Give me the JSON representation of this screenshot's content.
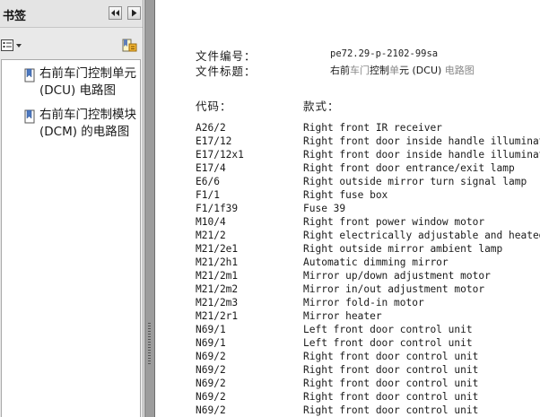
{
  "sidebar": {
    "title": "书签",
    "collapse_icon": "double-chevron-left-icon",
    "expand_icon": "triangle-right-icon",
    "options_icon": "bookmark-options-icon",
    "properties_icon": "bookmark-properties-icon",
    "items": [
      {
        "icon": "bookmark-icon",
        "label": "右前车门控制单元 (DCU) 电路图"
      },
      {
        "icon": "bookmark-icon",
        "label": "右前车门控制模块 (DCM) 的电路图"
      }
    ]
  },
  "document": {
    "doc_number_label": "文件编号：",
    "doc_number": "pe72.29-p-2102-99sa",
    "doc_title_label": "文件标题：",
    "doc_title_parts": [
      {
        "text": "右前",
        "tone": "dark"
      },
      {
        "text": "车门",
        "tone": "gray"
      },
      {
        "text": "控制",
        "tone": "dark"
      },
      {
        "text": "单",
        "tone": "gray"
      },
      {
        "text": "元 (DCU) ",
        "tone": "dark"
      },
      {
        "text": "电路图",
        "tone": "gray"
      }
    ],
    "col_code": "代码：",
    "col_desc": "款式：",
    "rows": [
      {
        "code": "A26/2",
        "desc": "Right front IR receiver"
      },
      {
        "code": "E17/12",
        "desc": "Right front door inside handle illumination"
      },
      {
        "code": "E17/12x1",
        "desc": "Right front door inside handle illumination"
      },
      {
        "code": "E17/4",
        "desc": "Right front door entrance/exit lamp"
      },
      {
        "code": "E6/6",
        "desc": "Right outside mirror turn signal lamp"
      },
      {
        "code": "F1/1",
        "desc": "Right fuse box"
      },
      {
        "code": "F1/1f39",
        "desc": "Fuse 39"
      },
      {
        "code": "M10/4",
        "desc": "Right front power window motor"
      },
      {
        "code": "M21/2",
        "desc": "Right electrically adjustable and heated out"
      },
      {
        "code": "M21/2e1",
        "desc": "Right outside mirror ambient lamp"
      },
      {
        "code": "M21/2h1",
        "desc": "Automatic dimming mirror"
      },
      {
        "code": "M21/2m1",
        "desc": "Mirror up/down adjustment motor"
      },
      {
        "code": "M21/2m2",
        "desc": "Mirror in/out adjustment motor"
      },
      {
        "code": "M21/2m3",
        "desc": "Mirror fold-in motor"
      },
      {
        "code": "M21/2r1",
        "desc": "Mirror heater"
      },
      {
        "code": "N69/1",
        "desc": "Left front door control unit"
      },
      {
        "code": "N69/1",
        "desc": "Left front door control unit"
      },
      {
        "code": "N69/2",
        "desc": "Right front door control unit"
      },
      {
        "code": "N69/2",
        "desc": "Right front door control unit"
      },
      {
        "code": "N69/2",
        "desc": "Right front door control unit"
      },
      {
        "code": "N69/2",
        "desc": "Right front door control unit"
      },
      {
        "code": "N69/2",
        "desc": "Right front door control unit"
      }
    ]
  }
}
